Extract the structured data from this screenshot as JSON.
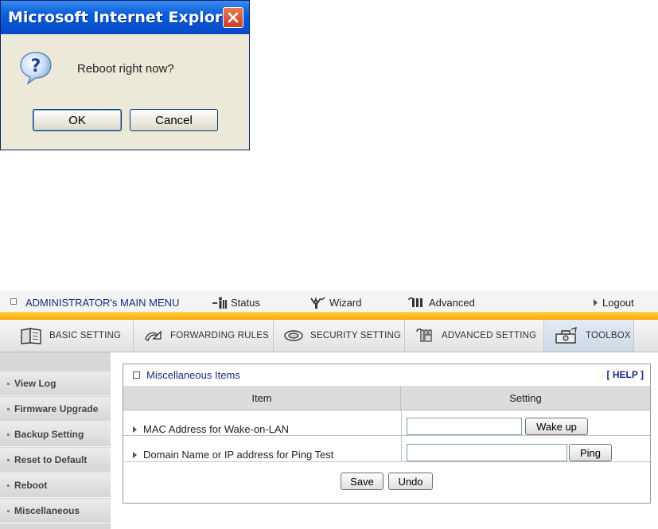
{
  "dialog": {
    "title": "Microsoft Internet Explorer",
    "message": "Reboot right now?",
    "ok_label": "OK",
    "cancel_label": "Cancel",
    "icon": "question-icon"
  },
  "menubar": {
    "title": "ADMINISTRATOR's MAIN MENU",
    "links": [
      "Status",
      "Wizard",
      "Advanced",
      "Logout"
    ]
  },
  "tabs": [
    {
      "label": "BASIC SETTING",
      "icon": "book-icon"
    },
    {
      "label": "FORWARDING RULES",
      "icon": "forward-icon"
    },
    {
      "label": "SECURITY SETTING",
      "icon": "shield-icon"
    },
    {
      "label": "ADVANCED SETTING",
      "icon": "gear-icon"
    },
    {
      "label": "TOOLBOX",
      "icon": "toolbox-icon",
      "active": true
    }
  ],
  "sidebar": {
    "items": [
      "View Log",
      "Firmware Upgrade",
      "Backup Setting",
      "Reset to Default",
      "Reboot",
      "Miscellaneous"
    ]
  },
  "panel": {
    "title": "Miscellaneous Items",
    "help": "[ HELP ]",
    "col_item": "Item",
    "col_setting": "Setting",
    "rows": [
      {
        "label": "MAC Address for Wake-on-LAN",
        "value": "",
        "button": "Wake up"
      },
      {
        "label": "Domain Name or IP address for Ping Test",
        "value": "",
        "button": "Ping"
      }
    ],
    "save_label": "Save",
    "undo_label": "Undo"
  },
  "colors": {
    "accent_orange": "#f7a800",
    "title_blue": "#1a2a80",
    "xp_title_blue": "#0a5fd8"
  }
}
